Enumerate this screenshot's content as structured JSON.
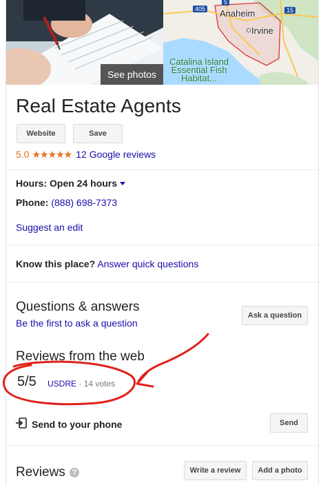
{
  "hero": {
    "see_photos_label": "See photos",
    "map_labels": {
      "highway_405": "405",
      "highway_5": "5",
      "highway_15": "15",
      "city_1": "Anaheim",
      "city_2": "Irvine",
      "place": "Catalina Island Essential Fish Habitat..."
    }
  },
  "business": {
    "title": "Real Estate Agents",
    "website_label": "Website",
    "save_label": "Save",
    "rating": "5.0",
    "stars": "★★★★★",
    "reviews_link": "12 Google reviews"
  },
  "info": {
    "hours_label": "Hours:",
    "hours_value": "Open 24 hours",
    "phone_label": "Phone:",
    "phone_value": "(888) 698-7373",
    "suggest_edit": "Suggest an edit"
  },
  "know_place": {
    "label": "Know this place?",
    "link": "Answer quick questions"
  },
  "qa": {
    "title": "Questions & answers",
    "subtitle": "Be the first to ask a question",
    "ask_button": "Ask a question"
  },
  "web_reviews": {
    "title": "Reviews from the web",
    "score": "5/5",
    "source": "USDRE",
    "separator": "·",
    "votes": "14 votes"
  },
  "send": {
    "label": "Send to your phone",
    "button": "Send"
  },
  "reviews": {
    "title": "Reviews",
    "help": "?",
    "write_button": "Write a review",
    "add_photo_button": "Add a photo"
  },
  "colors": {
    "link": "#1a0dab",
    "star": "#e7711b",
    "annotation": "#e0201a"
  }
}
